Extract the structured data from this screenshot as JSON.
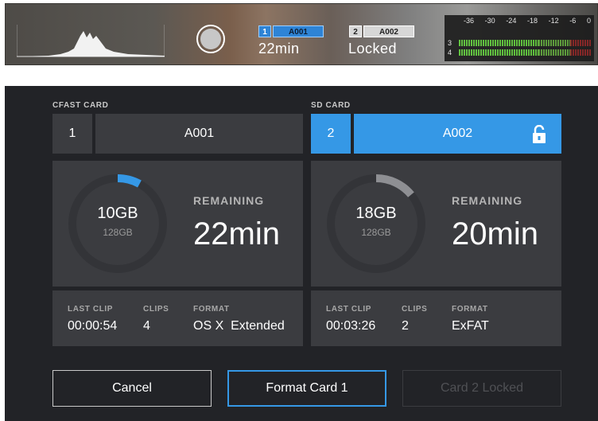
{
  "monitor": {
    "slot1": {
      "number": "1",
      "name": "A001",
      "value": "22min"
    },
    "slot2": {
      "number": "2",
      "name": "A002",
      "value": "Locked"
    },
    "meter_scale": [
      "-36",
      "-30",
      "-24",
      "-18",
      "-12",
      "-6",
      "0"
    ],
    "meter_channels": [
      "3",
      "4"
    ]
  },
  "cards": {
    "left": {
      "heading": "CFAST CARD",
      "slot_number": "1",
      "name": "A001",
      "used": "10GB",
      "capacity": "128GB",
      "used_fraction": 0.08,
      "remaining_label": "REMAINING",
      "remaining_value": "22min",
      "last_clip_label": "LAST CLIP",
      "last_clip": "00:00:54",
      "clips_label": "CLIPS",
      "clips": "4",
      "format_label": "FORMAT",
      "format": "OS X  Extended",
      "locked": false
    },
    "right": {
      "heading": "SD CARD",
      "slot_number": "2",
      "name": "A002",
      "used": "18GB",
      "capacity": "128GB",
      "used_fraction": 0.14,
      "remaining_label": "REMAINING",
      "remaining_value": "20min",
      "last_clip_label": "LAST CLIP",
      "last_clip": "00:03:26",
      "clips_label": "CLIPS",
      "clips": "2",
      "format_label": "FORMAT",
      "format": "ExFAT",
      "locked": true
    }
  },
  "buttons": {
    "cancel": "Cancel",
    "format": "Format Card 1",
    "locked": "Card 2 Locked"
  },
  "colors": {
    "accent": "#3598e6",
    "ring_track": "#333438",
    "ring_used_left": "#3598e6",
    "ring_used_right": "#8e8f93"
  },
  "icons": {
    "record": "record-button-icon",
    "lock": "unlock-icon"
  }
}
